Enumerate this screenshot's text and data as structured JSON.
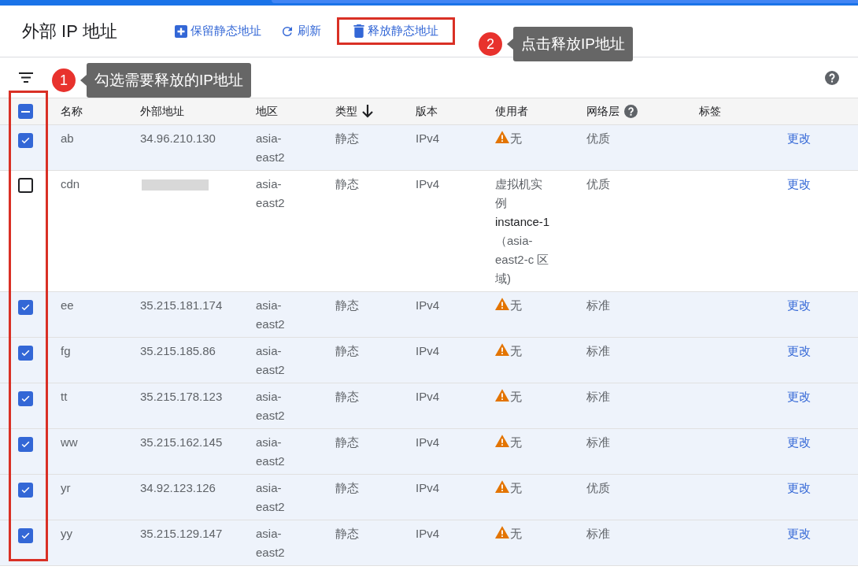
{
  "header": {
    "title": "外部 IP 地址",
    "actions": [
      {
        "kind": "add",
        "label": "保留静态地址",
        "highlighted": false
      },
      {
        "kind": "refresh",
        "label": "刷新",
        "highlighted": false
      },
      {
        "kind": "delete",
        "label": "释放静态地址",
        "highlighted": true
      }
    ]
  },
  "annotations": [
    {
      "number": "1",
      "text": "勾选需要释放的IP地址"
    },
    {
      "number": "2",
      "text": "点击释放IP地址"
    }
  ],
  "table": {
    "select_all_indeterminate": true,
    "checkbox_column_highlighted": true,
    "columns": [
      {
        "label": "名称",
        "sorted": false,
        "help": false
      },
      {
        "label": "外部地址",
        "sorted": false,
        "help": false
      },
      {
        "label": "地区",
        "sorted": false,
        "help": false
      },
      {
        "label": "类型",
        "sorted": true,
        "help": false
      },
      {
        "label": "版本",
        "sorted": false,
        "help": false
      },
      {
        "label": "使用者",
        "sorted": false,
        "help": false
      },
      {
        "label": "网络层",
        "sorted": false,
        "help": true
      },
      {
        "label": "标签",
        "sorted": false,
        "help": false
      }
    ],
    "rows": [
      {
        "checked": true,
        "name": "ab",
        "address": "34.96.210.130",
        "address_redacted": false,
        "region": "asia-east2",
        "type": "静态",
        "version": "IPv4",
        "user": {
          "kind": "none",
          "text": "无"
        },
        "tier": "优质",
        "action": "更改"
      },
      {
        "checked": false,
        "name": "cdn",
        "address_redacted": true,
        "region": "asia-east2",
        "type": "静态",
        "version": "IPv4",
        "user": {
          "kind": "instance",
          "prefix": "虚拟机实例",
          "instance": "instance-1",
          "suffix": "（asia-east2-c 区域)"
        },
        "tier": "优质",
        "action": "更改"
      },
      {
        "checked": true,
        "name": "ee",
        "address": "35.215.181.174",
        "address_redacted": false,
        "region": "asia-east2",
        "type": "静态",
        "version": "IPv4",
        "user": {
          "kind": "none",
          "text": "无"
        },
        "tier": "标准",
        "action": "更改"
      },
      {
        "checked": true,
        "name": "fg",
        "address": "35.215.185.86",
        "address_redacted": false,
        "region": "asia-east2",
        "type": "静态",
        "version": "IPv4",
        "user": {
          "kind": "none",
          "text": "无"
        },
        "tier": "标准",
        "action": "更改"
      },
      {
        "checked": true,
        "name": "tt",
        "address": "35.215.178.123",
        "address_redacted": false,
        "region": "asia-east2",
        "type": "静态",
        "version": "IPv4",
        "user": {
          "kind": "none",
          "text": "无"
        },
        "tier": "标准",
        "action": "更改"
      },
      {
        "checked": true,
        "name": "ww",
        "address": "35.215.162.145",
        "address_redacted": false,
        "region": "asia-east2",
        "type": "静态",
        "version": "IPv4",
        "user": {
          "kind": "none",
          "text": "无"
        },
        "tier": "标准",
        "action": "更改"
      },
      {
        "checked": true,
        "name": "yr",
        "address": "34.92.123.126",
        "address_redacted": false,
        "region": "asia-east2",
        "type": "静态",
        "version": "IPv4",
        "user": {
          "kind": "none",
          "text": "无"
        },
        "tier": "优质",
        "action": "更改"
      },
      {
        "checked": true,
        "name": "yy",
        "address": "35.215.129.147",
        "address_redacted": false,
        "region": "asia-east2",
        "type": "静态",
        "version": "IPv4",
        "user": {
          "kind": "none",
          "text": "无"
        },
        "tier": "标准",
        "action": "更改"
      }
    ]
  }
}
